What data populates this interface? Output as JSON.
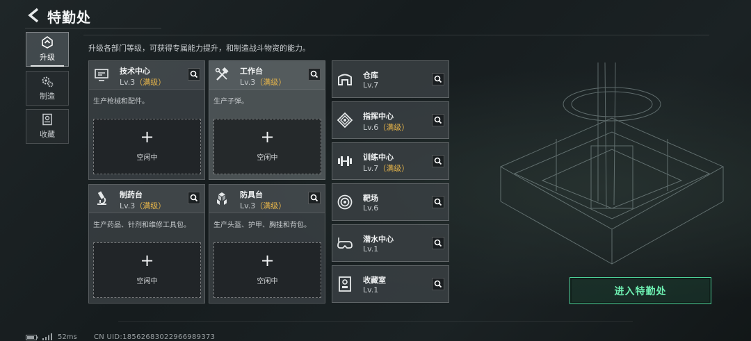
{
  "header": {
    "title": "特勤处"
  },
  "description": "升级各部门等级，可获得专属能力提升，和制造战斗物资的能力。",
  "nav": [
    {
      "label": "升级",
      "icon": "upgrade-icon",
      "active": true
    },
    {
      "label": "制造",
      "icon": "gears-icon",
      "active": false
    },
    {
      "label": "收藏",
      "icon": "collection-icon",
      "active": false
    }
  ],
  "facilities": [
    {
      "name": "技术中心",
      "level": "Lv.3",
      "status": "（满级）",
      "desc": "生产枪械和配件。",
      "slot": "空闲中",
      "icon": "computer-icon"
    },
    {
      "name": "工作台",
      "level": "Lv.3",
      "status": "（满级）",
      "desc": "生产子弹。",
      "slot": "空闲中",
      "icon": "tools-icon"
    },
    {
      "name": "制药台",
      "level": "Lv.3",
      "status": "（满级）",
      "desc": "生产药品、针剂和维修工具包。",
      "slot": "空闲中",
      "icon": "microscope-icon"
    },
    {
      "name": "防具台",
      "level": "Lv.3",
      "status": "（满级）",
      "desc": "生产头盔、护甲、胸挂和背包。",
      "slot": "空闲中",
      "icon": "armor-icon"
    }
  ],
  "small_facilities": [
    {
      "name": "仓库",
      "level": "Lv.7",
      "status": "",
      "icon": "warehouse-icon"
    },
    {
      "name": "指挥中心",
      "level": "Lv.6",
      "status": "（满级）",
      "icon": "command-icon"
    },
    {
      "name": "训练中心",
      "level": "Lv.7",
      "status": "（满级）",
      "icon": "dumbbell-icon"
    },
    {
      "name": "靶场",
      "level": "Lv.6",
      "status": "",
      "icon": "target-icon"
    },
    {
      "name": "潜水中心",
      "level": "Lv.1",
      "status": "",
      "icon": "diving-mask-icon"
    },
    {
      "name": "收藏室",
      "level": "Lv.1",
      "status": "",
      "icon": "display-case-icon"
    }
  ],
  "enter_button": "进入特勤处",
  "footer": {
    "latency": "52ms",
    "uid": "CN UID:18562683022966989373"
  }
}
